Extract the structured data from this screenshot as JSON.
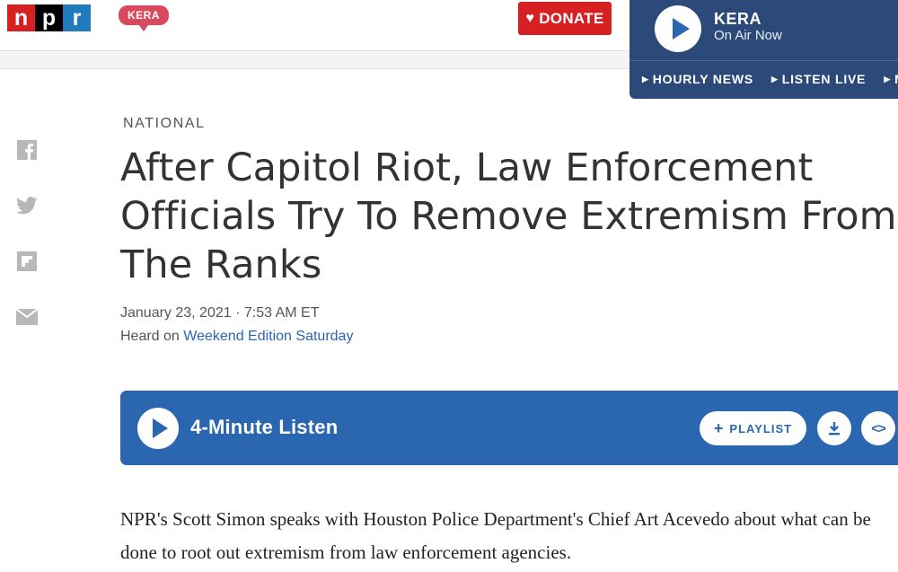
{
  "header": {
    "npr_logo_letters": [
      "n",
      "p",
      "r"
    ],
    "station_logo": "KERA",
    "donate_label": "DONATE",
    "colors": {
      "npr_red": "#d62021",
      "npr_blue": "#237bbd",
      "kera_pink": "#d94a5e",
      "player_navy": "#2b4a7a"
    }
  },
  "on_air": {
    "station": "KERA",
    "status": "On Air Now",
    "links": [
      "HOURLY NEWS",
      "LISTEN LIVE",
      "M"
    ]
  },
  "share": {
    "icons": [
      "facebook-icon",
      "twitter-icon",
      "flipboard-icon",
      "email-icon"
    ]
  },
  "article": {
    "kicker": "NATIONAL",
    "headline": "After Capitol Riot, Law Enforcement Officials Try To Remove Extremism From The Ranks",
    "dateline": "January 23, 2021 · 7:53 AM ET",
    "heard_on_prefix": "Heard on",
    "heard_on_program": "Weekend Edition Saturday",
    "teaser": "NPR's Scott Simon speaks with Houston Police Department's Chief Art Acevedo about what can be done to root out extremism from law enforcement agencies."
  },
  "audio": {
    "title": "4-Minute Listen",
    "playlist_label": "PLAYLIST",
    "accent_color": "#2b66b0"
  }
}
